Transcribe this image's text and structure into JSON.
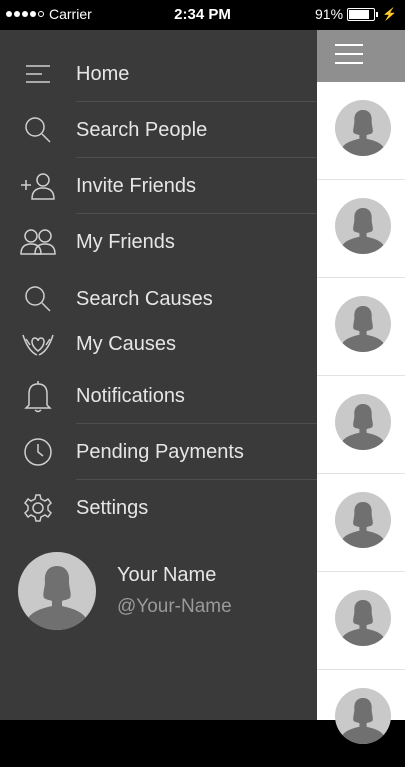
{
  "status": {
    "carrier": "Carrier",
    "time": "2:34 PM",
    "battery": "91%",
    "battery_level": 0.91
  },
  "menu": [
    {
      "label": "Home",
      "icon": "home-lines-icon"
    },
    {
      "label": "Search People",
      "icon": "search-icon"
    },
    {
      "label": "Invite Friends",
      "icon": "add-person-icon"
    },
    {
      "label": "My Friends",
      "icon": "people-icon"
    },
    {
      "label": "Search Causes",
      "icon": "search-icon"
    },
    {
      "label": "My Causes",
      "icon": "heart-hands-icon"
    },
    {
      "label": "Notifications",
      "icon": "bell-icon"
    },
    {
      "label": "Pending Payments",
      "icon": "clock-icon"
    },
    {
      "label": "Settings",
      "icon": "gear-icon"
    }
  ],
  "profile": {
    "name": "Your Name",
    "handle": "@Your-Name"
  },
  "colors": {
    "drawer_bg": "#3a3a3a",
    "header_bg": "#8f8f8f",
    "avatar_bg": "#c9c9c9",
    "avatar_silhouette": "#707070"
  }
}
